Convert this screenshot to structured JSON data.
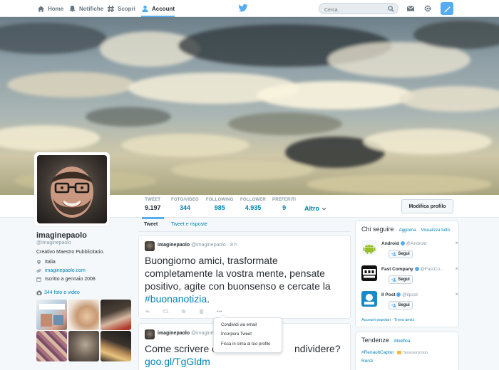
{
  "nav": {
    "items": [
      {
        "label": "Home",
        "icon": "home-icon"
      },
      {
        "label": "Notifiche",
        "icon": "bell-icon"
      },
      {
        "label": "Scopri",
        "icon": "hashtag-icon"
      },
      {
        "label": "Account",
        "icon": "person-icon"
      }
    ],
    "active": "Account",
    "search_placeholder": "Cerca"
  },
  "profile": {
    "stats": [
      {
        "label": "TWEET",
        "value": "9.197"
      },
      {
        "label": "FOTO/VIDEO",
        "value": "344"
      },
      {
        "label": "FOLLOWING",
        "value": "985"
      },
      {
        "label": "FOLLOWER",
        "value": "4.935"
      },
      {
        "label": "PREFERITI",
        "value": "9"
      }
    ],
    "more_label": "Altro",
    "edit_label": "Modifica profilo",
    "name": "imaginepaolo",
    "handle": "@imaginepaolo",
    "bio": "Creativo Maestro Pubblicitario.",
    "location": "Italia",
    "website": "imaginepaolo.com",
    "joined": "Iscritto a gennaio 2008",
    "photos_label": "344 foto e video"
  },
  "stream": {
    "tabs": [
      "Tweet",
      "Tweet e risposte"
    ],
    "tweets": [
      {
        "user": "imaginepaolo",
        "meta": "@imaginepaolo · 8 h",
        "text": "Buongiorno amici, trasformate completamente la vostra mente, pensate positivo, agite con buonsenso e cercate la",
        "hashtag": "#buonanotizia",
        "tail": "."
      },
      {
        "user": "imaginepaolo",
        "meta": "@imaginepaolo · 8 h",
        "text_start": "Come scrivere c",
        "text_end": "ndividere?",
        "link": "goo.gl/TgGldm"
      }
    ],
    "menu": [
      "Condividi via email",
      "Incorpora Tweet",
      "Fissa in cima al tuo profilo"
    ]
  },
  "who_to_follow": {
    "title": "Chi seguire",
    "refresh": "Aggiorna",
    "view_all": "Visualizza tutto",
    "sep": "·",
    "accounts": [
      {
        "name": "Android",
        "handle": "@Android",
        "follow": "Segui"
      },
      {
        "name": "Fast Company",
        "handle": "@FastCo...",
        "follow": "Segui"
      },
      {
        "name": "Il Post",
        "handle": "@ilpost",
        "follow": "Segui"
      }
    ],
    "popular": "Account popolari",
    "find_friends": "Trova amici"
  },
  "trends": {
    "title": "Tendenze",
    "change": "Modifica",
    "sep": "·",
    "items": [
      "#RenaultCaptur",
      "Renzi"
    ],
    "sponsored": "Sponsorizzato"
  },
  "colors": {
    "accent": "#55acee",
    "link": "#0084b4",
    "text": "#292f33",
    "muted": "#8899a6"
  }
}
